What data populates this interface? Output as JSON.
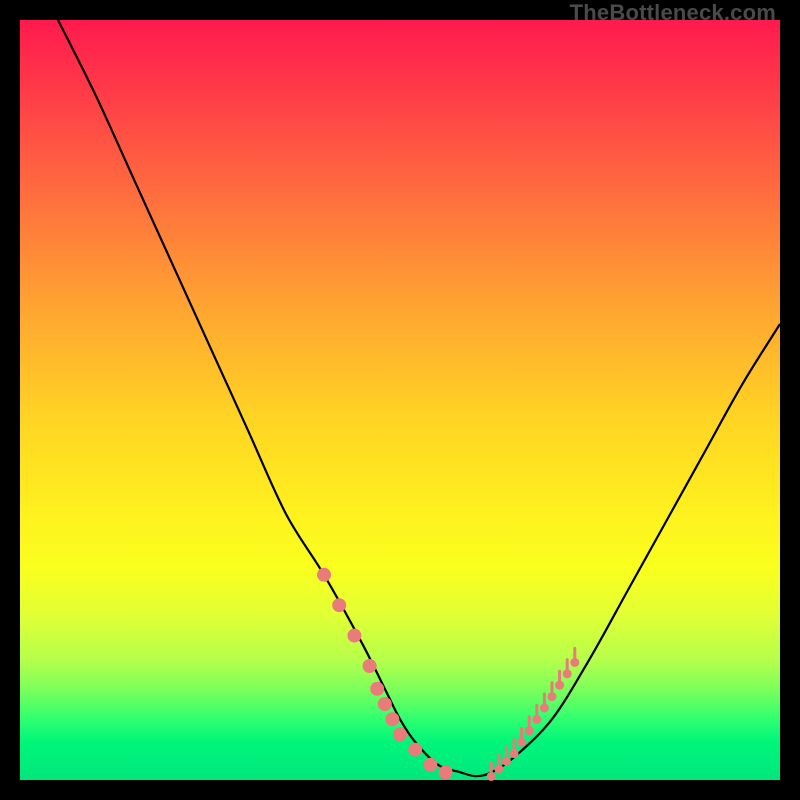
{
  "watermark": "TheBottleneck.com",
  "chart_data": {
    "type": "line",
    "title": "",
    "xlabel": "",
    "ylabel": "",
    "xlim": [
      0,
      100
    ],
    "ylim": [
      0,
      100
    ],
    "grid": false,
    "legend": false,
    "gradient_stops": [
      {
        "pos": 0,
        "color": "#ff1a4d"
      },
      {
        "pos": 22,
        "color": "#ff6a3f"
      },
      {
        "pos": 52,
        "color": "#ffd324"
      },
      {
        "pos": 72,
        "color": "#faff1e"
      },
      {
        "pos": 88,
        "color": "#7dff5a"
      },
      {
        "pos": 100,
        "color": "#00e77c"
      }
    ],
    "series": [
      {
        "name": "bottleneck-curve",
        "color": "#000000",
        "x": [
          5,
          10,
          15,
          20,
          25,
          30,
          35,
          40,
          45,
          48,
          50,
          52,
          55,
          58,
          60,
          62,
          65,
          70,
          75,
          80,
          85,
          90,
          95,
          100
        ],
        "y": [
          100,
          90,
          79,
          68,
          57,
          46,
          35,
          27,
          18,
          12,
          8,
          5,
          2,
          1,
          0.5,
          1,
          3,
          8,
          16,
          25,
          34,
          43,
          52,
          60
        ]
      },
      {
        "name": "left-dots",
        "type": "scatter",
        "color": "#e97b7b",
        "x": [
          40,
          42,
          44,
          46,
          47,
          48,
          49,
          50,
          52,
          54,
          56
        ],
        "y": [
          27,
          23,
          19,
          15,
          12,
          10,
          8,
          6,
          4,
          2,
          1
        ]
      },
      {
        "name": "right-ticks",
        "type": "scatter",
        "color": "#e97b7b",
        "x": [
          62,
          63,
          64,
          65,
          66,
          67,
          68,
          69,
          70,
          71,
          72,
          73
        ],
        "y": [
          1,
          2,
          3,
          4,
          5.5,
          7,
          8.5,
          10,
          11.5,
          13,
          14.5,
          16
        ]
      }
    ]
  }
}
